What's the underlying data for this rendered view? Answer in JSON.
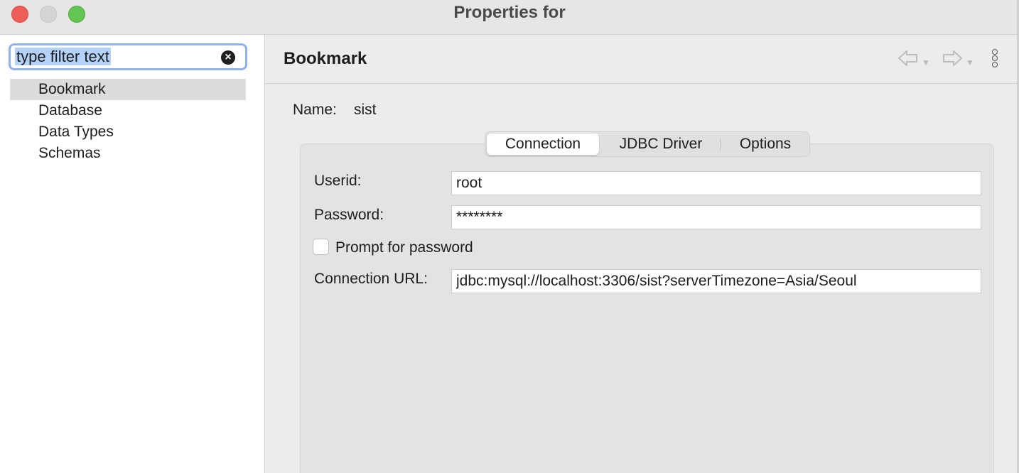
{
  "window": {
    "title": "Properties for"
  },
  "sidebar": {
    "filter": {
      "value": "type filter text"
    },
    "items": [
      {
        "label": "Bookmark",
        "selected": true
      },
      {
        "label": "Database",
        "selected": false
      },
      {
        "label": "Data Types",
        "selected": false
      },
      {
        "label": "Schemas",
        "selected": false
      }
    ]
  },
  "main": {
    "title": "Bookmark",
    "name_label": "Name:",
    "name_value": "sist",
    "tabs": [
      {
        "label": "Connection",
        "active": true
      },
      {
        "label": "JDBC Driver",
        "active": false
      },
      {
        "label": "Options",
        "active": false
      }
    ],
    "form": {
      "userid_label": "Userid:",
      "userid_value": "root",
      "password_label": "Password:",
      "password_value": "********",
      "prompt_label": "Prompt for password",
      "prompt_checked": false,
      "url_label": "Connection URL:",
      "url_value": "jdbc:mysql://localhost:3306/sist?serverTimezone=Asia/Seoul"
    }
  },
  "icons": {
    "back": "back-arrow-icon",
    "forward": "forward-arrow-icon",
    "menu": "view-menu-icon",
    "clear": "clear-search-icon"
  },
  "colors": {
    "selection": "#b4d3fb",
    "focus_ring": "#8fb3ea",
    "close": "#ee5f57",
    "maximize": "#61c654"
  }
}
